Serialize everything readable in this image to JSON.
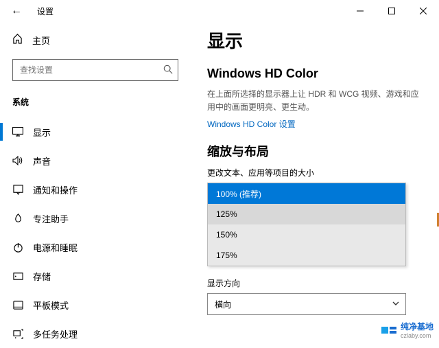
{
  "window": {
    "title": "设置"
  },
  "sidebar": {
    "home": "主页",
    "search_placeholder": "查找设置",
    "category": "系统",
    "items": [
      {
        "label": "显示"
      },
      {
        "label": "声音"
      },
      {
        "label": "通知和操作"
      },
      {
        "label": "专注助手"
      },
      {
        "label": "电源和睡眠"
      },
      {
        "label": "存储"
      },
      {
        "label": "平板模式"
      },
      {
        "label": "多任务处理"
      }
    ]
  },
  "main": {
    "title": "显示",
    "hd_section": "Windows HD Color",
    "hd_desc": "在上面所选择的显示器上让 HDR 和 WCG 视频、游戏和应用中的画面更明亮、更生动。",
    "hd_link": "Windows HD Color 设置",
    "scale_section": "缩放与布局",
    "scale_label": "更改文本、应用等项目的大小",
    "scale_options": [
      "100% (推荐)",
      "125%",
      "150%",
      "175%"
    ],
    "orientation_label": "显示方向",
    "orientation_value": "横向"
  },
  "watermark": {
    "cn": "纯净基地",
    "en": "czlaby.com"
  }
}
